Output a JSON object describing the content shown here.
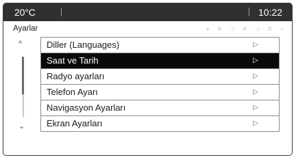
{
  "status_bar": {
    "temperature": "20°C",
    "clock": "10:22"
  },
  "header": {
    "title": "Ayarlar",
    "status_icons": "⩔ ✉ ◿ ✕ ◿ ✆ ○"
  },
  "menu": {
    "items": [
      {
        "label": "Diller (Languages)",
        "selected": false
      },
      {
        "label": "Saat ve Tarih",
        "selected": true
      },
      {
        "label": "Radyo ayarları",
        "selected": false
      },
      {
        "label": "Telefon Ayarı",
        "selected": false
      },
      {
        "label": "Navigasyon Ayarları",
        "selected": false
      },
      {
        "label": "Ekran Ayarları",
        "selected": false
      }
    ],
    "arrow_glyph": "▷"
  },
  "scroll": {
    "up_glyph": "^",
    "down_glyph": "⌄"
  },
  "colors": {
    "topbar": "#303030",
    "selected_row": "#0a0a0a",
    "border": "#8a8a8a"
  }
}
